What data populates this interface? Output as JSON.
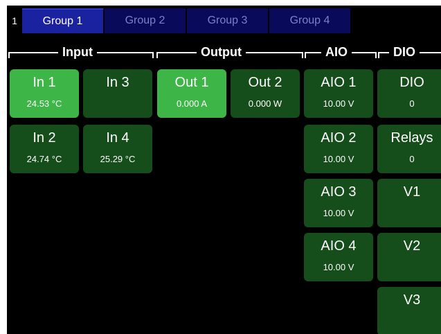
{
  "tabs": {
    "index": "1",
    "items": [
      {
        "label": "Group 1"
      },
      {
        "label": "Group 2"
      },
      {
        "label": "Group 3"
      },
      {
        "label": "Group 4"
      }
    ]
  },
  "sections": {
    "input": "Input",
    "output": "Output",
    "aio": "AIO",
    "dio": "DIO"
  },
  "input_tiles": [
    {
      "name": "In 1",
      "value": "24.53 °C",
      "state": "on"
    },
    {
      "name": "In 3",
      "value": "",
      "state": "off"
    },
    {
      "name": "In 2",
      "value": "24.74 °C",
      "state": "off"
    },
    {
      "name": "In 4",
      "value": "25.29 °C",
      "state": "off"
    }
  ],
  "output_tiles": [
    {
      "name": "Out 1",
      "value": "0.000 A",
      "state": "on"
    },
    {
      "name": "Out 2",
      "value": "0.000 W",
      "state": "off"
    }
  ],
  "aio_tiles": [
    {
      "name": "AIO 1",
      "value": "10.00 V"
    },
    {
      "name": "AIO 2",
      "value": "10.00 V"
    },
    {
      "name": "AIO 3",
      "value": "10.00 V"
    },
    {
      "name": "AIO 4",
      "value": "10.00 V"
    }
  ],
  "dio_tiles": [
    {
      "name": "DIO",
      "value": "0"
    },
    {
      "name": "Relays",
      "value": "0"
    },
    {
      "name": "V1",
      "value": ""
    },
    {
      "name": "V2",
      "value": ""
    },
    {
      "name": "V3",
      "value": ""
    }
  ],
  "colors": {
    "tile_on": "#3db547",
    "tile_off": "#154d1b",
    "tab_active": "#1a22a0",
    "tab_inactive": "#0a0a5a"
  }
}
